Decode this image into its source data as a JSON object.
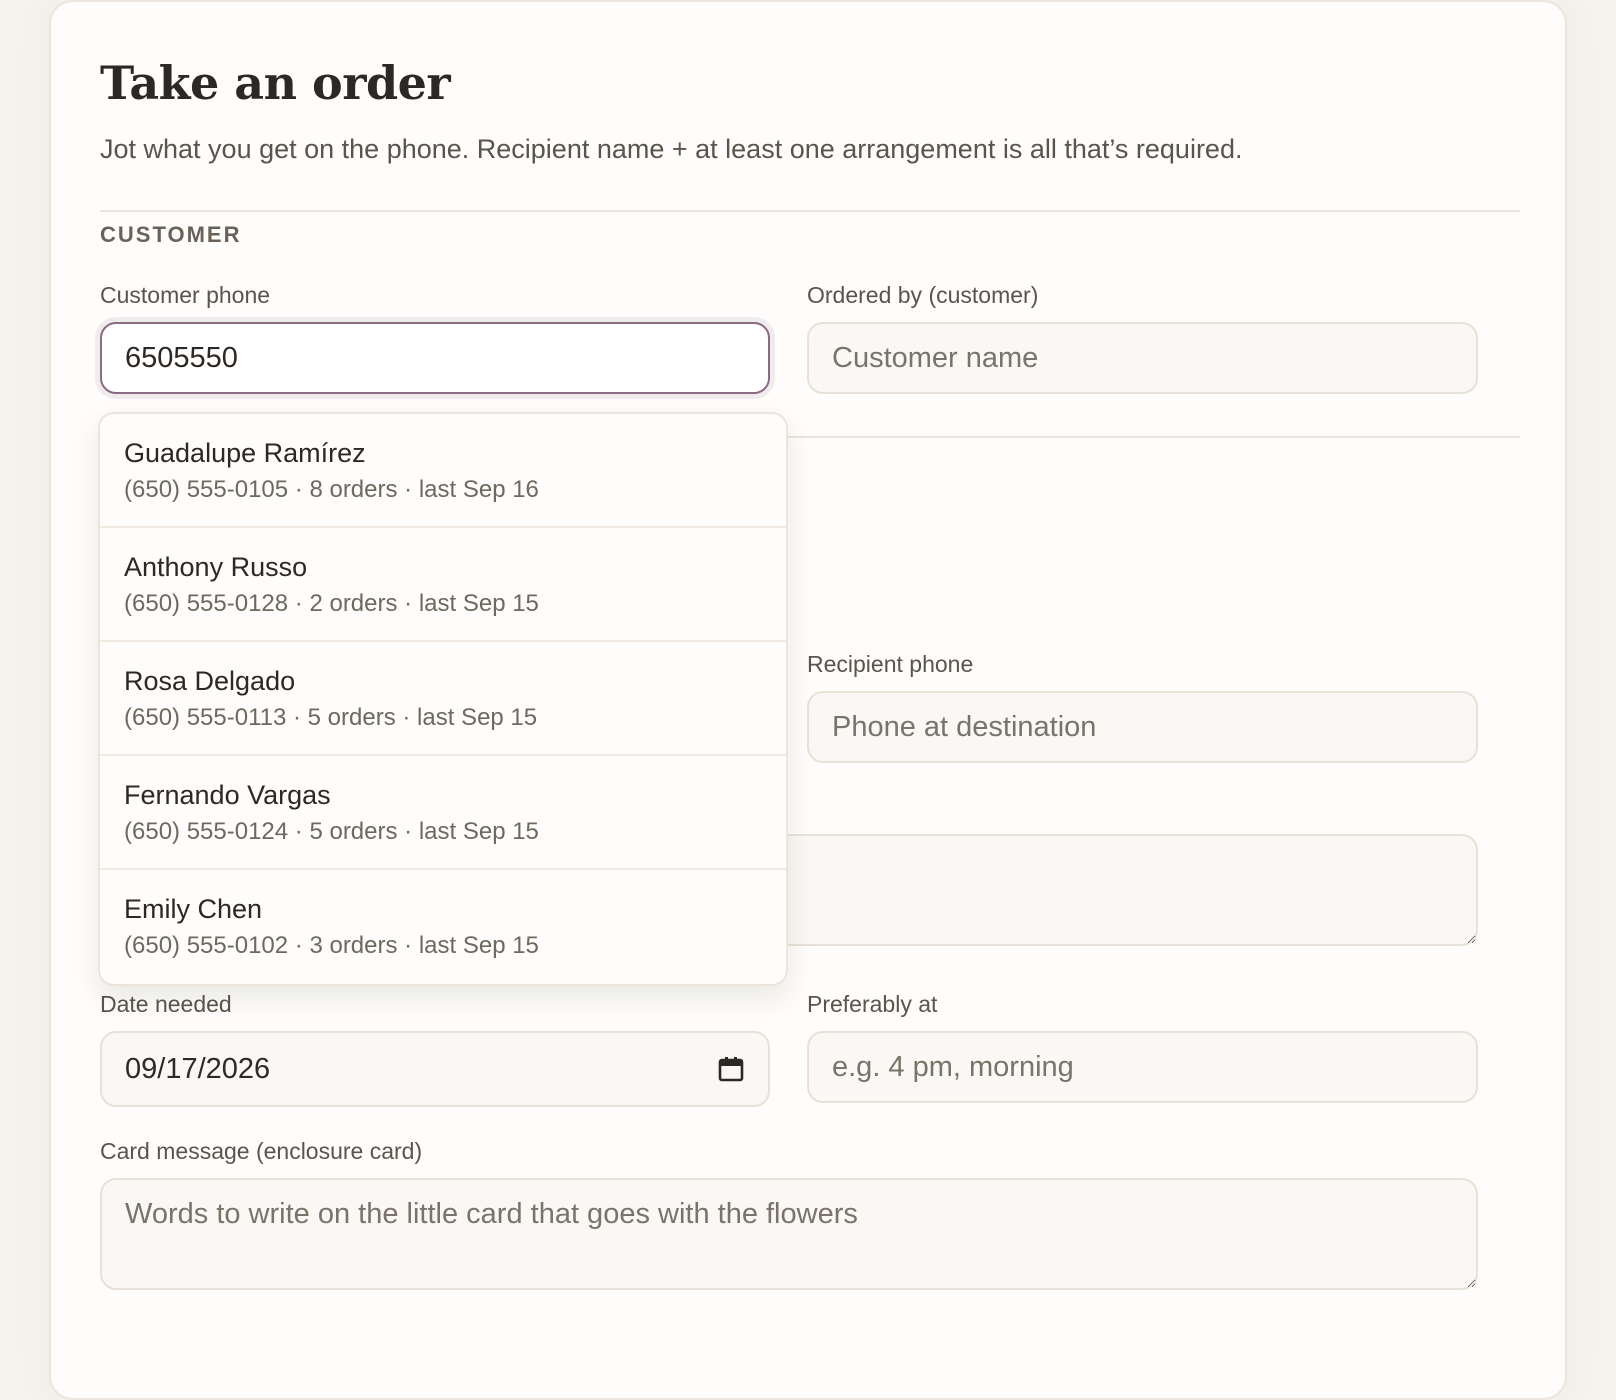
{
  "form": {
    "title": "Take an order",
    "subtitle": "Jot what you get on the phone. Recipient name + at least one arrangement is all that’s required."
  },
  "customer_section": {
    "heading": "CUSTOMER",
    "phone_label": "Customer phone",
    "phone_value": "6505550",
    "ordered_by_label": "Ordered by (customer)",
    "ordered_by_placeholder": "Customer name"
  },
  "suggestions": [
    {
      "name": "Guadalupe Ramírez",
      "meta": "(650) 555-0105 · 8 orders · last Sep 16"
    },
    {
      "name": "Anthony Russo",
      "meta": "(650) 555-0128 · 2 orders · last Sep 15"
    },
    {
      "name": "Rosa Delgado",
      "meta": "(650) 555-0113 · 5 orders · last Sep 15"
    },
    {
      "name": "Fernando Vargas",
      "meta": "(650) 555-0124 · 5 orders · last Sep 15"
    },
    {
      "name": "Emily Chen",
      "meta": "(650) 555-0102 · 3 orders · last Sep 15"
    }
  ],
  "recipient": {
    "phone_label": "Recipient phone",
    "phone_placeholder": "Phone at destination"
  },
  "schedule": {
    "date_label": "Date needed",
    "date_value": "09/17/2026",
    "time_label": "Preferably at",
    "time_placeholder": "e.g. 4 pm, morning"
  },
  "card": {
    "label": "Card message (enclosure card)",
    "placeholder": "Words to write on the little card that goes with the flowers"
  },
  "icons": {
    "calendar": "calendar-icon"
  },
  "colors": {
    "focus_border": "#8b6a84",
    "background": "#f6f3ee",
    "card": "#fefdfb"
  }
}
